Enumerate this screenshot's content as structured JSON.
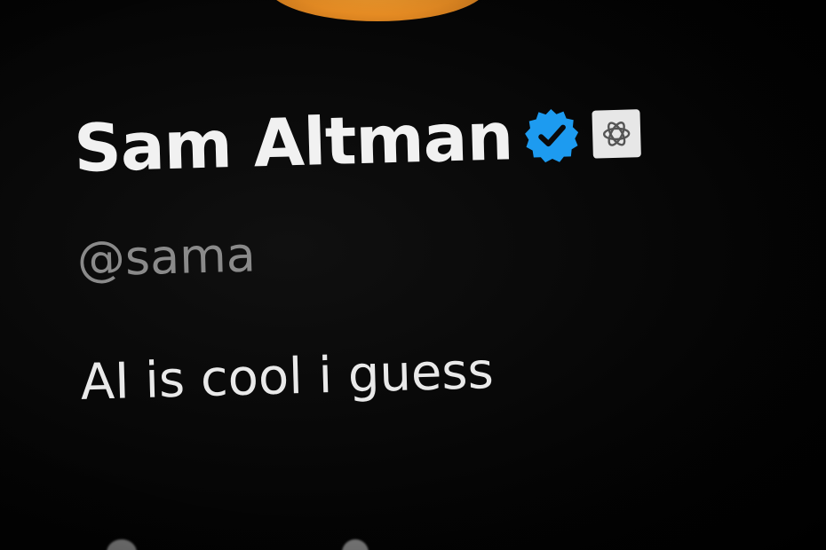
{
  "profile": {
    "display_name": "Sam Altman",
    "handle": "@sama",
    "bio": "AI is cool i guess",
    "verified_icon": "verified-badge-icon",
    "affiliate_icon": "openai-logo-icon"
  },
  "colors": {
    "background": "#000000",
    "name": "#f1f1f1",
    "handle": "#8a8a8a",
    "bio": "#e9e9e9",
    "verified_blue": "#1d9bf0",
    "avatar_orange": "#e58b23"
  }
}
